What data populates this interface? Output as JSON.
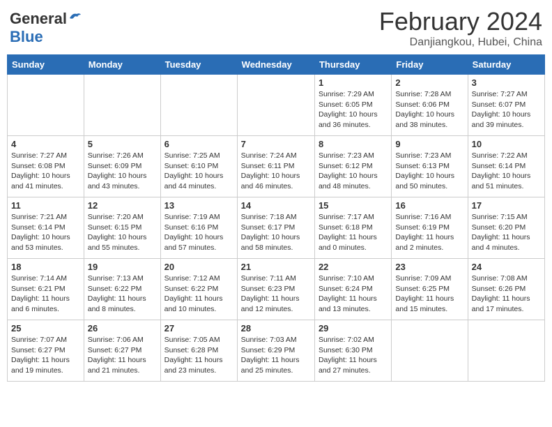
{
  "header": {
    "logo_general": "General",
    "logo_blue": "Blue",
    "month_title": "February 2024",
    "location": "Danjiangkou, Hubei, China"
  },
  "days_of_week": [
    "Sunday",
    "Monday",
    "Tuesday",
    "Wednesday",
    "Thursday",
    "Friday",
    "Saturday"
  ],
  "weeks": [
    [
      {
        "day": "",
        "info": ""
      },
      {
        "day": "",
        "info": ""
      },
      {
        "day": "",
        "info": ""
      },
      {
        "day": "",
        "info": ""
      },
      {
        "day": "1",
        "info": "Sunrise: 7:29 AM\nSunset: 6:05 PM\nDaylight: 10 hours and 36 minutes."
      },
      {
        "day": "2",
        "info": "Sunrise: 7:28 AM\nSunset: 6:06 PM\nDaylight: 10 hours and 38 minutes."
      },
      {
        "day": "3",
        "info": "Sunrise: 7:27 AM\nSunset: 6:07 PM\nDaylight: 10 hours and 39 minutes."
      }
    ],
    [
      {
        "day": "4",
        "info": "Sunrise: 7:27 AM\nSunset: 6:08 PM\nDaylight: 10 hours and 41 minutes."
      },
      {
        "day": "5",
        "info": "Sunrise: 7:26 AM\nSunset: 6:09 PM\nDaylight: 10 hours and 43 minutes."
      },
      {
        "day": "6",
        "info": "Sunrise: 7:25 AM\nSunset: 6:10 PM\nDaylight: 10 hours and 44 minutes."
      },
      {
        "day": "7",
        "info": "Sunrise: 7:24 AM\nSunset: 6:11 PM\nDaylight: 10 hours and 46 minutes."
      },
      {
        "day": "8",
        "info": "Sunrise: 7:23 AM\nSunset: 6:12 PM\nDaylight: 10 hours and 48 minutes."
      },
      {
        "day": "9",
        "info": "Sunrise: 7:23 AM\nSunset: 6:13 PM\nDaylight: 10 hours and 50 minutes."
      },
      {
        "day": "10",
        "info": "Sunrise: 7:22 AM\nSunset: 6:14 PM\nDaylight: 10 hours and 51 minutes."
      }
    ],
    [
      {
        "day": "11",
        "info": "Sunrise: 7:21 AM\nSunset: 6:14 PM\nDaylight: 10 hours and 53 minutes."
      },
      {
        "day": "12",
        "info": "Sunrise: 7:20 AM\nSunset: 6:15 PM\nDaylight: 10 hours and 55 minutes."
      },
      {
        "day": "13",
        "info": "Sunrise: 7:19 AM\nSunset: 6:16 PM\nDaylight: 10 hours and 57 minutes."
      },
      {
        "day": "14",
        "info": "Sunrise: 7:18 AM\nSunset: 6:17 PM\nDaylight: 10 hours and 58 minutes."
      },
      {
        "day": "15",
        "info": "Sunrise: 7:17 AM\nSunset: 6:18 PM\nDaylight: 11 hours and 0 minutes."
      },
      {
        "day": "16",
        "info": "Sunrise: 7:16 AM\nSunset: 6:19 PM\nDaylight: 11 hours and 2 minutes."
      },
      {
        "day": "17",
        "info": "Sunrise: 7:15 AM\nSunset: 6:20 PM\nDaylight: 11 hours and 4 minutes."
      }
    ],
    [
      {
        "day": "18",
        "info": "Sunrise: 7:14 AM\nSunset: 6:21 PM\nDaylight: 11 hours and 6 minutes."
      },
      {
        "day": "19",
        "info": "Sunrise: 7:13 AM\nSunset: 6:22 PM\nDaylight: 11 hours and 8 minutes."
      },
      {
        "day": "20",
        "info": "Sunrise: 7:12 AM\nSunset: 6:22 PM\nDaylight: 11 hours and 10 minutes."
      },
      {
        "day": "21",
        "info": "Sunrise: 7:11 AM\nSunset: 6:23 PM\nDaylight: 11 hours and 12 minutes."
      },
      {
        "day": "22",
        "info": "Sunrise: 7:10 AM\nSunset: 6:24 PM\nDaylight: 11 hours and 13 minutes."
      },
      {
        "day": "23",
        "info": "Sunrise: 7:09 AM\nSunset: 6:25 PM\nDaylight: 11 hours and 15 minutes."
      },
      {
        "day": "24",
        "info": "Sunrise: 7:08 AM\nSunset: 6:26 PM\nDaylight: 11 hours and 17 minutes."
      }
    ],
    [
      {
        "day": "25",
        "info": "Sunrise: 7:07 AM\nSunset: 6:27 PM\nDaylight: 11 hours and 19 minutes."
      },
      {
        "day": "26",
        "info": "Sunrise: 7:06 AM\nSunset: 6:27 PM\nDaylight: 11 hours and 21 minutes."
      },
      {
        "day": "27",
        "info": "Sunrise: 7:05 AM\nSunset: 6:28 PM\nDaylight: 11 hours and 23 minutes."
      },
      {
        "day": "28",
        "info": "Sunrise: 7:03 AM\nSunset: 6:29 PM\nDaylight: 11 hours and 25 minutes."
      },
      {
        "day": "29",
        "info": "Sunrise: 7:02 AM\nSunset: 6:30 PM\nDaylight: 11 hours and 27 minutes."
      },
      {
        "day": "",
        "info": ""
      },
      {
        "day": "",
        "info": ""
      }
    ]
  ]
}
